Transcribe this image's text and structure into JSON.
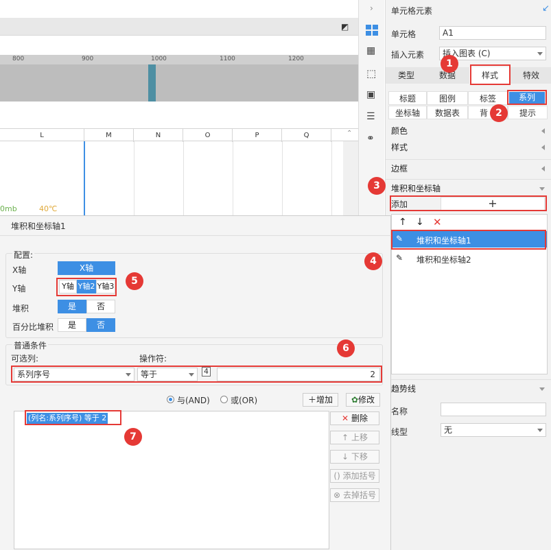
{
  "ruler": {
    "ticks": [
      "800",
      "900",
      "1000",
      "1100",
      "1200"
    ]
  },
  "columns": [
    "L",
    "M",
    "N",
    "O",
    "P",
    "Q"
  ],
  "cell_texts": {
    "left": "0mb",
    "right": "40℃"
  },
  "panel": {
    "title": "单元格元素",
    "cell_label": "单元格",
    "cell_value": "A1",
    "insert_label": "插入元素",
    "insert_value": "插入图表 (C)",
    "tabs": [
      "类型",
      "数据",
      "样式",
      "特效"
    ],
    "subtabs_row1": [
      "标题",
      "图例",
      "标签",
      "系列"
    ],
    "subtabs_row2": [
      "坐标轴",
      "数据表",
      "背",
      "提示"
    ],
    "sections": [
      "颜色",
      "样式",
      "边框",
      "堆积和坐标轴"
    ],
    "add_label": "添加",
    "add_icon": "+",
    "list_items": [
      "堆积和坐标轴1",
      "堆积和坐标轴2"
    ],
    "trend_title": "趋势线",
    "name_label": "名称",
    "linetype_label": "线型",
    "linetype_value": "无"
  },
  "dialog": {
    "title": "堆积和坐标轴1",
    "config_legend": "配置:",
    "xaxis_label": "X轴",
    "xaxis_btn": "X轴",
    "yaxis_label": "Y轴",
    "yaxis_btns": [
      "Y轴",
      "Y轴2",
      "Y轴3"
    ],
    "stack_label": "堆积",
    "pct_stack_label": "百分比堆积",
    "yes": "是",
    "no": "否",
    "cond_legend": "普通条件",
    "col_label": "可选列:",
    "op_label": "操作符:",
    "col_value": "系列序号",
    "op_value": "等于",
    "val_value": "2",
    "and_label": "与(AND)",
    "or_label": "或(OR)",
    "add_btn": "增加",
    "modify_btn": "修改",
    "condition": "(列名:系列序号) 等于 2",
    "delete_btn": "删除",
    "up_btn": "上移",
    "down_btn": "下移",
    "addparen_btn": "添加括号",
    "removeparen_btn": "去掉括号"
  },
  "badges": [
    "1",
    "2",
    "3",
    "4",
    "5",
    "6",
    "7"
  ],
  "colors": {
    "accent": "#3d8fe4",
    "highlight_red": "#e53935",
    "selected_row": "#3d8fe4"
  }
}
